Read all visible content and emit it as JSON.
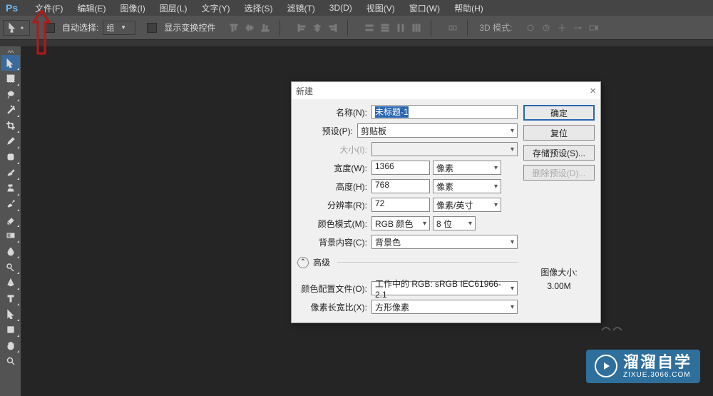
{
  "app": {
    "logo": "Ps"
  },
  "menu": {
    "file": "文件(F)",
    "edit": "编辑(E)",
    "image": "图像(I)",
    "layer": "图层(L)",
    "type": "文字(Y)",
    "select": "选择(S)",
    "filter": "滤镜(T)",
    "3d": "3D(D)",
    "view": "视图(V)",
    "window": "窗口(W)",
    "help": "帮助(H)"
  },
  "options": {
    "auto_select_label": "自动选择:",
    "auto_select_value": "组",
    "show_transform": "显示变换控件",
    "mode3d_label": "3D 模式:"
  },
  "dialog": {
    "title": "新建",
    "name_label": "名称(N):",
    "name_value": "未标题-1",
    "preset_label": "预设(P):",
    "preset_value": "剪贴板",
    "size_label": "大小(I):",
    "width_label": "宽度(W):",
    "width_value": "1366",
    "width_unit": "像素",
    "height_label": "高度(H):",
    "height_value": "768",
    "height_unit": "像素",
    "res_label": "分辨率(R):",
    "res_value": "72",
    "res_unit": "像素/英寸",
    "cmode_label": "颜色模式(M):",
    "cmode_value": "RGB 颜色",
    "cmode_depth": "8 位",
    "bg_label": "背景内容(C):",
    "bg_value": "背景色",
    "advanced_label": "高级",
    "profile_label": "颜色配置文件(O):",
    "profile_value": "工作中的 RGB: sRGB IEC61966-2.1",
    "pixel_ratio_label": "像素长宽比(X):",
    "pixel_ratio_value": "方形像素",
    "ok": "确定",
    "cancel": "复位",
    "save_preset": "存储预设(S)...",
    "delete_preset": "删除预设(D)...",
    "image_size_label": "图像大小:",
    "image_size_value": "3.00M"
  },
  "watermark": {
    "main": "溜溜自学",
    "sub": "ZIXUE.3066.COM"
  }
}
